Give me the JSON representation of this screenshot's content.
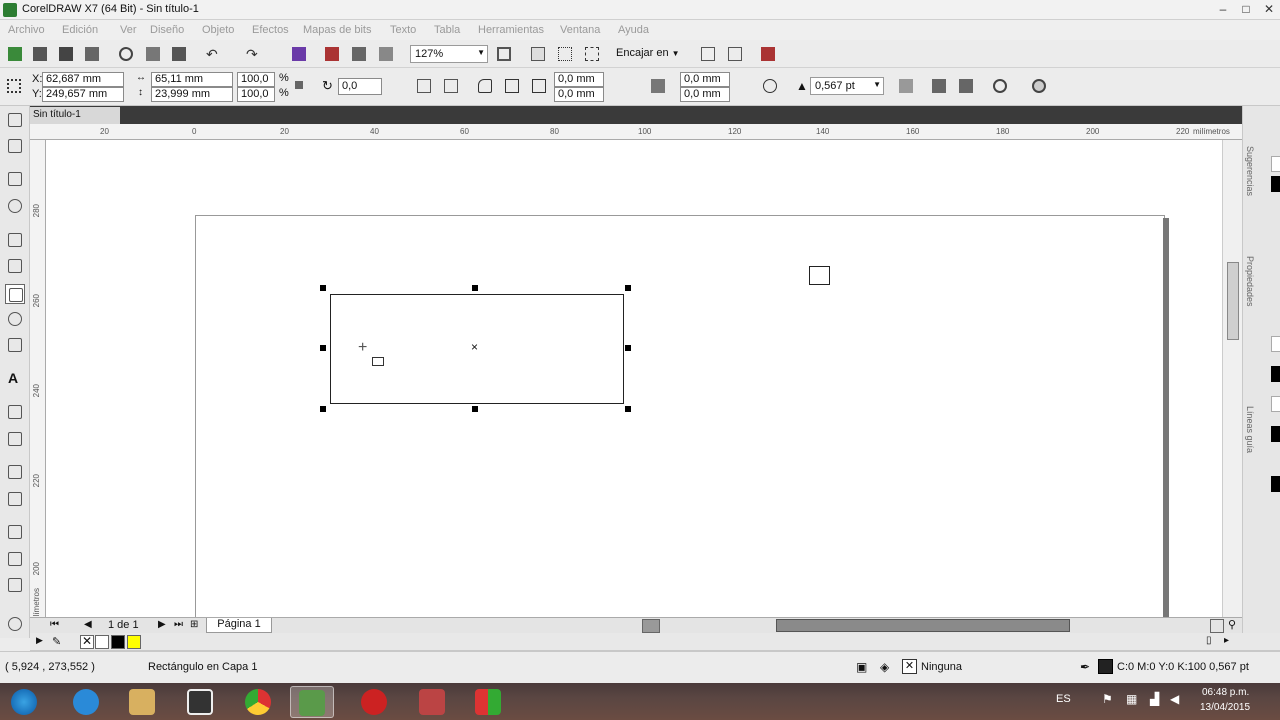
{
  "window": {
    "title": "CorelDRAW X7 (64 Bit) - Sin título-1"
  },
  "menu": [
    "Archivo",
    "Edición",
    "Ver",
    "Diseño",
    "Objeto",
    "Efectos",
    "Mapas de bits",
    "Texto",
    "Tabla",
    "Herramientas",
    "Ventana",
    "Ayuda"
  ],
  "toolbar": {
    "zoom": "127%",
    "snap_label": "Encajar en"
  },
  "props": {
    "x_label": "X:",
    "y_label": "Y:",
    "x": "62,687 mm",
    "y": "249,657 mm",
    "width": "65,11 mm",
    "height": "23,999 mm",
    "scale_w": "100,0",
    "scale_h": "100,0",
    "pct": "%",
    "rotation": "0,0",
    "corner1": "0,0 mm",
    "corner2": "0,0 mm",
    "corner3": "0,0 mm",
    "corner4": "0,0 mm",
    "outline": "0,567 pt"
  },
  "doc_tab": "Sin título-1",
  "ruler": {
    "h_ticks": [
      "20",
      "0",
      "20",
      "40",
      "60",
      "80",
      "100",
      "120",
      "140",
      "160",
      "180",
      "200",
      "220"
    ],
    "h_unit": "milímetros",
    "v_ticks": [
      "280",
      "260",
      "240",
      "220",
      "200"
    ],
    "v_unit": "milímetros"
  },
  "page_nav": {
    "counter": "1 de 1",
    "page_tab": "Página 1"
  },
  "dock_tabs": [
    "Sugerencias",
    "Propiedades",
    "Líneas guía"
  ],
  "palette": {
    "colors": [
      "#ffffff",
      "#000000",
      "#ffff00"
    ]
  },
  "status": {
    "coords": "( 5,924 , 273,552 )",
    "object": "Rectángulo en Capa 1",
    "fill": "Ninguna",
    "outline": "C:0 M:0 Y:0 K:100  0,567 pt"
  },
  "tray": {
    "lang": "ES",
    "time": "06:48 p.m.",
    "date": "13/04/2015"
  }
}
